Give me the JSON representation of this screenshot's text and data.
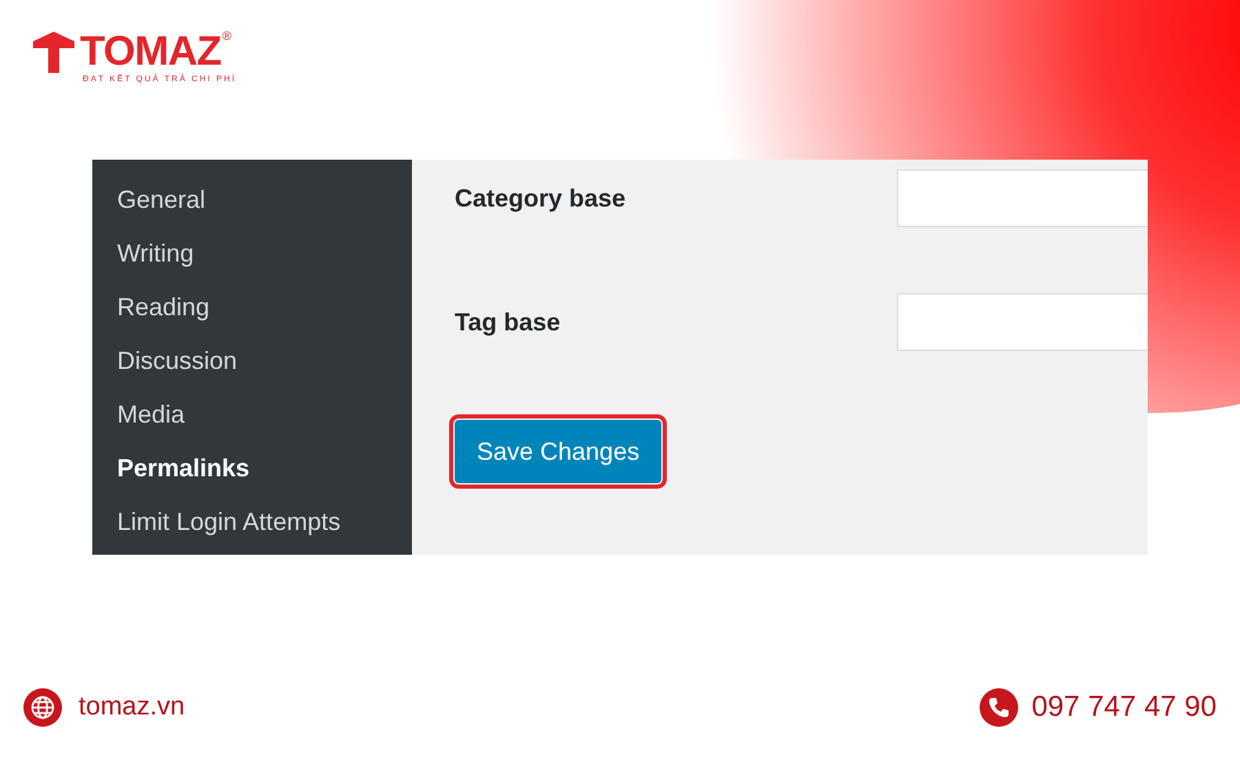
{
  "brand": {
    "name": "TOMAZ",
    "registered": "®",
    "tagline": "ĐẠT KẾT QUẢ TRẢ CHI PHÍ"
  },
  "sidebar": {
    "items": [
      {
        "label": "General",
        "selected": false
      },
      {
        "label": "Writing",
        "selected": false
      },
      {
        "label": "Reading",
        "selected": false
      },
      {
        "label": "Discussion",
        "selected": false
      },
      {
        "label": "Media",
        "selected": false
      },
      {
        "label": "Permalinks",
        "selected": true
      },
      {
        "label": "Limit Login Attempts",
        "selected": false
      }
    ]
  },
  "fields": [
    {
      "label": "Category base"
    },
    {
      "label": "Tag base"
    }
  ],
  "save_button": {
    "label": "Save Changes",
    "highlighted": true
  },
  "footer": {
    "website": "tomaz.vn",
    "phone": "097 747 47 90"
  }
}
